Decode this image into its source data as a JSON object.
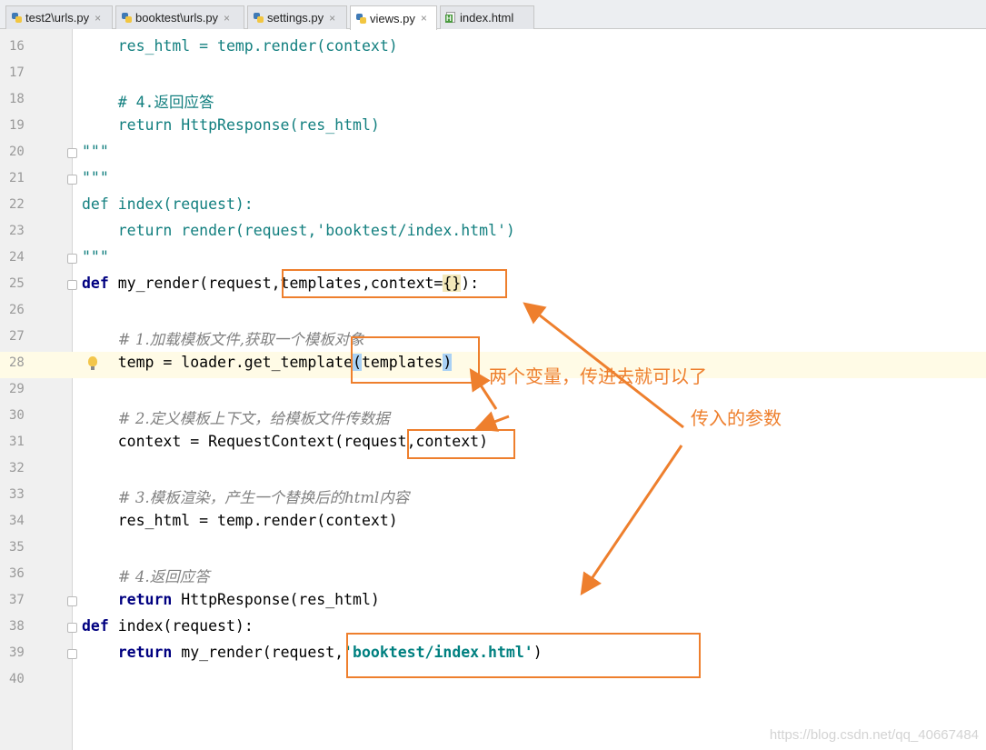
{
  "tabs": [
    {
      "label": "test2\\urls.py",
      "type": "py",
      "active": false
    },
    {
      "label": "booktest\\urls.py",
      "type": "py",
      "active": false
    },
    {
      "label": "settings.py",
      "type": "py",
      "active": false
    },
    {
      "label": "views.py",
      "type": "py",
      "active": true
    },
    {
      "label": "index.html",
      "type": "html",
      "active": false
    }
  ],
  "close_glyph": "×",
  "code_lines": [
    {
      "num": "16",
      "parts": [
        [
          "teal",
          "    res_html = temp.render(context)"
        ]
      ]
    },
    {
      "num": "17",
      "parts": []
    },
    {
      "num": "18",
      "parts": [
        [
          "teal",
          "    # 4.返回应答"
        ]
      ]
    },
    {
      "num": "19",
      "parts": [
        [
          "teal",
          "    return HttpResponse(res_html)"
        ]
      ]
    },
    {
      "num": "20",
      "parts": [
        [
          "teal",
          "\"\"\""
        ]
      ],
      "fold": true
    },
    {
      "num": "21",
      "parts": [
        [
          "teal",
          "\"\"\""
        ]
      ],
      "fold": true
    },
    {
      "num": "22",
      "parts": [
        [
          "teal",
          "def index(request):"
        ]
      ]
    },
    {
      "num": "23",
      "parts": [
        [
          "teal",
          "    return render(request,'booktest/index.html')"
        ]
      ]
    },
    {
      "num": "24",
      "parts": [
        [
          "teal",
          "\"\"\""
        ]
      ],
      "fold": true
    },
    {
      "num": "25",
      "parts": [
        [
          "kw",
          "def"
        ],
        [
          "",
          " my_render(request,templates,context="
        ],
        [
          "hlb",
          "{}"
        ],
        [
          "",
          "):"
        ]
      ],
      "fold": true
    },
    {
      "num": "26",
      "parts": []
    },
    {
      "num": "27",
      "parts": [
        [
          "",
          "    "
        ],
        [
          "cm",
          "# 1.加载模板文件,获取一个模板对象"
        ]
      ]
    },
    {
      "num": "28",
      "parts": [
        [
          "",
          "    temp = loader.get_template"
        ],
        [
          "hl",
          "("
        ],
        [
          "",
          "templates"
        ],
        [
          "hl",
          ")"
        ]
      ],
      "current": true,
      "bulb": true
    },
    {
      "num": "29",
      "parts": []
    },
    {
      "num": "30",
      "parts": [
        [
          "",
          "    "
        ],
        [
          "cm",
          "# 2.定义模板上下文，给模板文件传数据"
        ]
      ]
    },
    {
      "num": "31",
      "parts": [
        [
          "",
          "    context = RequestContext(request,context)"
        ]
      ]
    },
    {
      "num": "32",
      "parts": []
    },
    {
      "num": "33",
      "parts": [
        [
          "",
          "    "
        ],
        [
          "cm",
          "# 3.模板渲染，产生一个替换后的html内容"
        ]
      ]
    },
    {
      "num": "34",
      "parts": [
        [
          "",
          "    res_html = temp.render(context)"
        ]
      ]
    },
    {
      "num": "35",
      "parts": []
    },
    {
      "num": "36",
      "parts": [
        [
          "",
          "    "
        ],
        [
          "cm",
          "# 4.返回应答"
        ]
      ]
    },
    {
      "num": "37",
      "parts": [
        [
          "",
          "    "
        ],
        [
          "kw",
          "return"
        ],
        [
          "",
          " HttpResponse(res_html)"
        ]
      ],
      "fold": true
    },
    {
      "num": "38",
      "parts": [
        [
          "kw",
          "def"
        ],
        [
          "",
          " index(request):"
        ]
      ],
      "fold": true
    },
    {
      "num": "39",
      "parts": [
        [
          "",
          "    "
        ],
        [
          "kw",
          "return"
        ],
        [
          "",
          " my_render(request,"
        ],
        [
          "str",
          "'booktest/index.html'"
        ],
        [
          "",
          ")"
        ]
      ],
      "fold": true
    },
    {
      "num": "40",
      "parts": []
    }
  ],
  "annotations": {
    "two_vars": "两个变量，传进去就可以了",
    "passed_params": "传入的参数"
  },
  "watermark": "https://blog.csdn.net/qq_40667484",
  "colors": {
    "annotation": "#ee7f2d",
    "keyword": "#000080",
    "string": "#008080",
    "comment": "#808080"
  }
}
